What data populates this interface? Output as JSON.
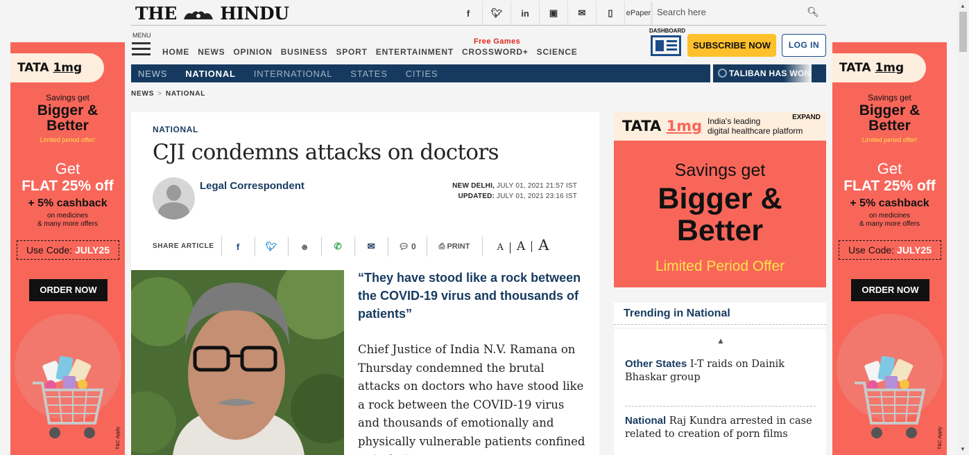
{
  "masthead": {
    "brand_left": "THE",
    "brand_right": "HINDU",
    "epaper": "ePaper",
    "search_placeholder": "Search here"
  },
  "header": {
    "menu_label": "MENU",
    "free_games": "Free Games",
    "dashboard_label": "DASHBOARD",
    "subscribe": "SUBSCRIBE NOW",
    "login": "LOG IN",
    "nav": [
      "HOME",
      "NEWS",
      "OPINION",
      "BUSINESS",
      "SPORT",
      "ENTERTAINMENT",
      "CROSSWORD+",
      "SCIENCE"
    ]
  },
  "section_nav": {
    "items": [
      "NEWS",
      "NATIONAL",
      "INTERNATIONAL",
      "STATES",
      "CITIES"
    ],
    "ticker": "TALIBAN HAS WON"
  },
  "breadcrumb": {
    "first": "NEWS",
    "sep": ">",
    "second": "NATIONAL"
  },
  "article": {
    "kicker": "NATIONAL",
    "headline": "CJI condemns attacks on doctors",
    "author": "Legal Correspondent",
    "dateline_place": "NEW DELHI,",
    "dateline_date": " JULY 01, 2021 21:57 IST",
    "updated_label": "UPDATED:",
    "updated_date": " JULY 01, 2021 23:16 IST",
    "share_label": "SHARE ARTICLE",
    "comments": "0",
    "print": "PRINT",
    "font_sizes": [
      "A",
      "A",
      "A"
    ],
    "pullquote": "“They have stood like a rock between the COVID-19 virus and thousands of patients”",
    "body": "Chief Justice of India N.V. Ramana on Thursday condemned the brutal attacks on doctors who have stood like a rock between the COVID-19 virus and thousands of emotionally and physically vulnerable patients confined to isolation"
  },
  "side_ad": {
    "logo_a": "TATA ",
    "logo_b": "1mg",
    "savings": "Savings get",
    "bigger": "Bigger &",
    "better": "Better",
    "limited": "Limited period offer!",
    "get": "Get",
    "flat": "FLAT 25% off",
    "cashback": "+ 5% cashback",
    "on_medicines": "on medicines",
    "more_offers": "& many more offers",
    "use_code": "Use Code: ",
    "code": "JULY25",
    "order": "ORDER NOW",
    "tc": "T&C Apply"
  },
  "right_ad": {
    "logo_a": "TATA ",
    "logo_b": "1mg",
    "tagline_1": "India's leading",
    "tagline_2": "digital healthcare platform",
    "expand": "EXPAND",
    "savings": "Savings get",
    "bigger": "Bigger &",
    "better": "Better",
    "limited": "Limited Period Offer"
  },
  "trending": {
    "title": "Trending in National",
    "items": [
      {
        "category": "Other States",
        "text": "I-T raids on Dainik Bhaskar group"
      },
      {
        "category": "National",
        "text": "Raj Kundra arrested in case related to creation of porn films"
      }
    ]
  },
  "colors": {
    "navy": "#163a5f",
    "ad_coral": "#f8665a",
    "subscribe_yellow": "#fec02b",
    "alert_red": "#e0261b"
  }
}
